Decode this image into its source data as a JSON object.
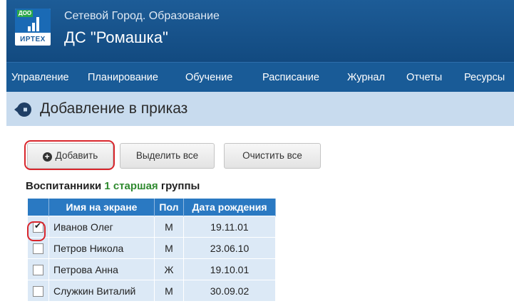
{
  "header": {
    "logo_tag": "ДОО",
    "logo_brand": "ИРТЕХ",
    "app_name": "Сетевой Город. Образование",
    "org_name": "ДС \"Ромашка\""
  },
  "nav": {
    "items": [
      "Управление",
      "Планирование",
      "Обучение",
      "Расписание",
      "Журнал",
      "Отчеты",
      "Ресурсы"
    ]
  },
  "page": {
    "title": "Добавление в приказ",
    "back_icon": "arrow-left-circle-icon"
  },
  "toolbar": {
    "add_label": "Добавить",
    "add_icon": "plus-circle-icon",
    "select_all_label": "Выделить все",
    "clear_all_label": "Очистить все"
  },
  "group": {
    "prefix": "Воспитанники",
    "name": "1 старшая",
    "suffix": "группы"
  },
  "table": {
    "columns": [
      "Имя на экране",
      "Пол",
      "Дата рождения"
    ],
    "rows": [
      {
        "checked": true,
        "name": "Иванов Олег",
        "sex": "М",
        "dob": "19.11.01"
      },
      {
        "checked": false,
        "name": "Петров Никола",
        "sex": "М",
        "dob": "23.06.10"
      },
      {
        "checked": false,
        "name": "Петрова Анна",
        "sex": "Ж",
        "dob": "19.10.01"
      },
      {
        "checked": false,
        "name": "Служкин Виталий",
        "sex": "М",
        "dob": "30.09.02"
      }
    ]
  },
  "colors": {
    "header_bg": "#1d5c97",
    "nav_bg": "#195b97",
    "title_bar_bg": "#c8dbee",
    "table_header_bg": "#2a79c2",
    "table_row_bg": "#dce9f6",
    "highlight": "#d9262c",
    "group_name": "#2f8a2f"
  }
}
